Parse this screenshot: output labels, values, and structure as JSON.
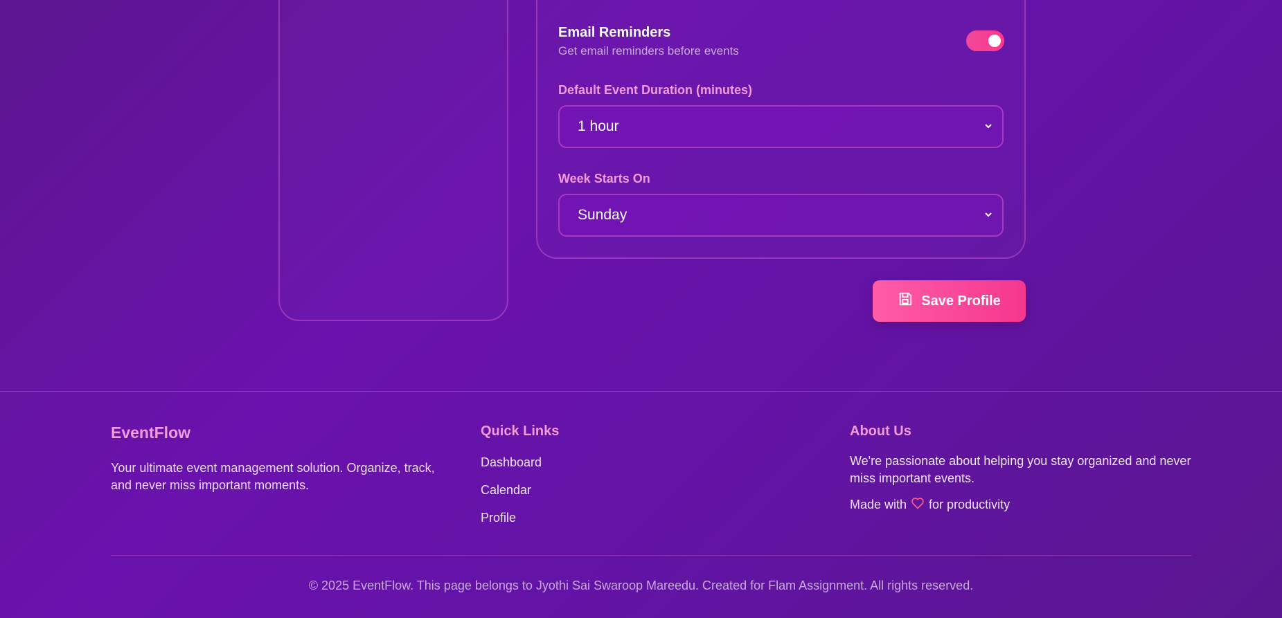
{
  "settings": {
    "email_reminders": {
      "title": "Email Reminders",
      "description": "Get email reminders before events",
      "enabled": true
    },
    "duration": {
      "label": "Default Event Duration (minutes)",
      "value": "1 hour"
    },
    "week_start": {
      "label": "Week Starts On",
      "value": "Sunday"
    }
  },
  "actions": {
    "save_label": "Save Profile"
  },
  "footer": {
    "brand": "EventFlow",
    "brand_description": "Your ultimate event management solution. Organize, track, and never miss important moments.",
    "quick_links": {
      "title": "Quick Links",
      "items": [
        "Dashboard",
        "Calendar",
        "Profile"
      ]
    },
    "about": {
      "title": "About Us",
      "text": "We're passionate about helping you stay organized and never miss important events.",
      "made_with_prefix": "Made with",
      "made_with_suffix": "for productivity"
    },
    "copyright": "© 2025 EventFlow. This page belongs to Jyothi Sai Swaroop Mareedu. Created for Flam Assignment. All rights reserved."
  },
  "icons": {
    "select_chevron": "chevron-down-icon",
    "save": "save-icon",
    "heart": "heart-icon"
  },
  "colors": {
    "accent_pink": "#f5378e",
    "label_pink": "#f29bd6",
    "background_purple": "#6a12ad"
  }
}
